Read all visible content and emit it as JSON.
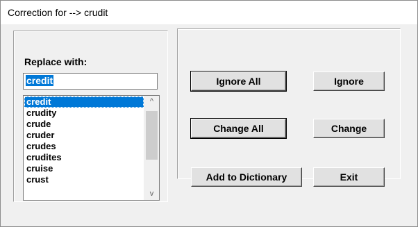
{
  "window": {
    "title": "Correction for -->  crudit"
  },
  "replace": {
    "label": "Replace with:",
    "value": "credit"
  },
  "suggestions": {
    "items": [
      "credit",
      "crudity",
      "crude",
      "cruder",
      "crudes",
      "crudites",
      "cruise",
      "crust"
    ],
    "selected_index": 0
  },
  "scrollbar": {
    "up_icon": "chevron-up-icon",
    "down_icon": "chevron-down-icon",
    "up_glyph": "^",
    "down_glyph": "v"
  },
  "buttons": {
    "ignore_all": "Ignore All",
    "ignore": "Ignore",
    "change_all": "Change All",
    "change": "Change",
    "add_to_dictionary": "Add to Dictionary",
    "exit": "Exit"
  },
  "colors": {
    "selection": "#0078d7",
    "face": "#f0f0f0",
    "button": "#e1e1e1"
  }
}
